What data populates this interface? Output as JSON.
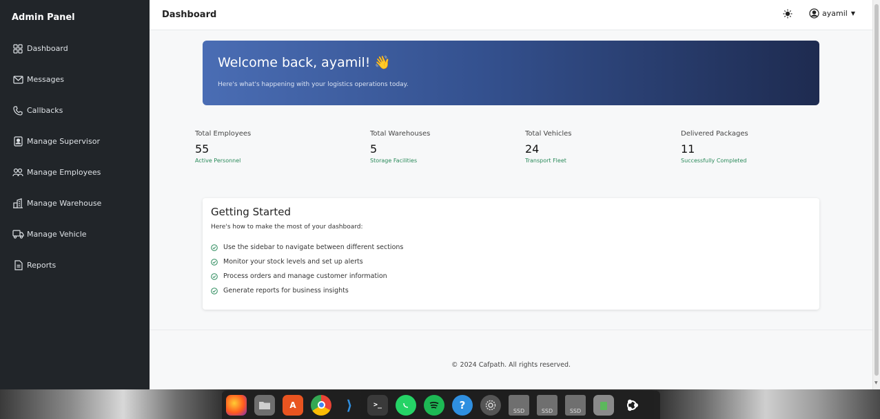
{
  "sidebar": {
    "brand": "Admin Panel",
    "items": [
      {
        "label": "Dashboard",
        "icon": "grid-icon"
      },
      {
        "label": "Messages",
        "icon": "envelope-icon"
      },
      {
        "label": "Callbacks",
        "icon": "phone-icon"
      },
      {
        "label": "Manage Supervisor",
        "icon": "person-badge-icon"
      },
      {
        "label": "Manage Employees",
        "icon": "people-icon"
      },
      {
        "label": "Manage Warehouse",
        "icon": "building-icon"
      },
      {
        "label": "Manage Vehicle",
        "icon": "truck-icon"
      },
      {
        "label": "Reports",
        "icon": "document-icon"
      }
    ]
  },
  "topbar": {
    "title": "Dashboard",
    "theme_icon": "sun-icon",
    "username": "ayamil"
  },
  "welcome": {
    "heading": "Welcome back, ayamil! 👋",
    "subtitle": "Here's what's happening with your logistics operations today."
  },
  "stats": [
    {
      "label": "Total Employees",
      "value": "55",
      "sub": "Active Personnel"
    },
    {
      "label": "Total Warehouses",
      "value": "5",
      "sub": "Storage Facilities"
    },
    {
      "label": "Total Vehicles",
      "value": "24",
      "sub": "Transport Fleet"
    },
    {
      "label": "Delivered Packages",
      "value": "11",
      "sub": "Successfully Completed"
    }
  ],
  "getting_started": {
    "title": "Getting Started",
    "subtitle": "Here's how to make the most of your dashboard:",
    "items": [
      "Use the sidebar to navigate between different sections",
      "Monitor your stock levels and set up alerts",
      "Process orders and manage customer information",
      "Generate reports for business insights"
    ]
  },
  "footer": {
    "text": "© 2024 Cafpath. All rights reserved."
  },
  "colors": {
    "sidebar_bg": "#212529",
    "accent_green": "#2a8a5a",
    "banner_start": "#4a6db4",
    "banner_end": "#1e2b50"
  },
  "dock": {
    "apps": [
      "firefox-icon",
      "files-icon",
      "app-center-icon",
      "chrome-icon",
      "vscode-icon",
      "terminal-icon",
      "whatsapp-icon",
      "spotify-icon",
      "help-icon",
      "settings-icon",
      "ssd-drive-icon",
      "ssd-drive-icon",
      "ssd-drive-icon",
      "trash-icon",
      "ubuntu-icon"
    ],
    "ssd_label": "SSD"
  }
}
